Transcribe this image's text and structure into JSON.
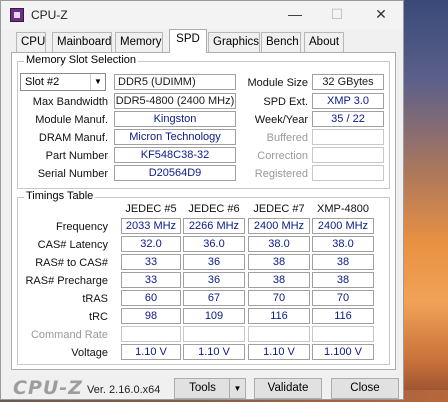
{
  "window": {
    "title": "CPU-Z",
    "minimize_icon": "—",
    "maximize_icon": "☐",
    "close_icon": "✕"
  },
  "tabs": [
    {
      "label": "CPU"
    },
    {
      "label": "Mainboard"
    },
    {
      "label": "Memory"
    },
    {
      "label": "SPD",
      "active": true
    },
    {
      "label": "Graphics"
    },
    {
      "label": "Bench"
    },
    {
      "label": "About"
    }
  ],
  "slot_section": {
    "title": "Memory Slot Selection",
    "selected_slot": "Slot #2",
    "memory_type": "DDR5 (UDIMM)",
    "module_size_label": "Module Size",
    "module_size": "32 GBytes",
    "max_bandwidth_label": "Max Bandwidth",
    "max_bandwidth": "DDR5-4800 (2400 MHz)",
    "spd_ext_label": "SPD Ext.",
    "spd_ext": "XMP 3.0",
    "module_manuf_label": "Module Manuf.",
    "module_manuf": "Kingston",
    "week_year_label": "Week/Year",
    "week_year": "35 / 22",
    "dram_manuf_label": "DRAM Manuf.",
    "dram_manuf": "Micron Technology",
    "buffered_label": "Buffered",
    "part_number_label": "Part Number",
    "part_number": "KF548C38-32",
    "correction_label": "Correction",
    "serial_number_label": "Serial Number",
    "serial_number": "D20564D9",
    "registered_label": "Registered"
  },
  "timings": {
    "title": "Timings Table",
    "columns": [
      "JEDEC #5",
      "JEDEC #6",
      "JEDEC #7",
      "XMP-4800"
    ],
    "rows": [
      {
        "label": "Frequency",
        "values": [
          "2033 MHz",
          "2266 MHz",
          "2400 MHz",
          "2400 MHz"
        ]
      },
      {
        "label": "CAS# Latency",
        "values": [
          "32.0",
          "36.0",
          "38.0",
          "38.0"
        ]
      },
      {
        "label": "RAS# to CAS#",
        "values": [
          "33",
          "36",
          "38",
          "38"
        ]
      },
      {
        "label": "RAS# Precharge",
        "values": [
          "33",
          "36",
          "38",
          "38"
        ]
      },
      {
        "label": "tRAS",
        "values": [
          "60",
          "67",
          "70",
          "70"
        ]
      },
      {
        "label": "tRC",
        "values": [
          "98",
          "109",
          "116",
          "116"
        ]
      },
      {
        "label": "Command Rate",
        "values": [
          "",
          "",
          "",
          ""
        ],
        "disabled": true
      },
      {
        "label": "Voltage",
        "values": [
          "1.10 V",
          "1.10 V",
          "1.10 V",
          "1.100 V"
        ]
      }
    ]
  },
  "footer": {
    "logo": "CPU-Z",
    "version": "Ver. 2.16.0.x64",
    "tools_label": "Tools",
    "validate_label": "Validate",
    "close_label": "Close"
  }
}
